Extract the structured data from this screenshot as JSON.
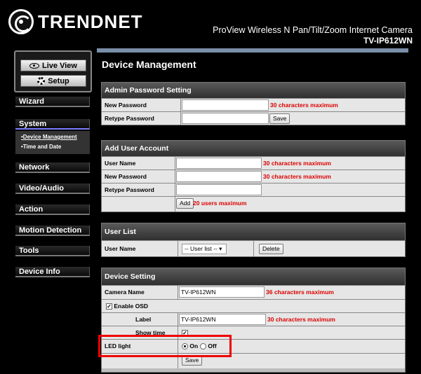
{
  "header": {
    "brand": "TRENDNET",
    "product_title": "ProView Wireless N Pan/Tilt/Zoom Internet Camera",
    "model": "TV-IP612WN"
  },
  "toolbox": {
    "live_view": "Live View",
    "setup": "Setup"
  },
  "sidebar": {
    "items": [
      "Wizard",
      "System",
      "Network",
      "Video/Audio",
      "Action",
      "Motion Detection",
      "Tools",
      "Device Info"
    ],
    "submenu": [
      "•Device Management",
      "•Time and Date"
    ]
  },
  "main": {
    "title": "Device Management",
    "admin": {
      "title": "Admin Password Setting",
      "new_password_label": "New Password",
      "retype_label": "Retype Password",
      "hint": "30 characters maximum",
      "save": "Save"
    },
    "add_user": {
      "title": "Add User Account",
      "user_name_label": "User Name",
      "new_password_label": "New Password",
      "retype_label": "Retype Password",
      "hint": "30 characters maximum",
      "add": "Add",
      "add_hint": "20 users maximum"
    },
    "user_list": {
      "title": "User List",
      "user_name_label": "User Name",
      "select_value": "-- User list --",
      "delete": "Delete"
    },
    "device": {
      "title": "Device Setting",
      "camera_name_label": "Camera Name",
      "camera_name_value": "TV-IP612WN",
      "camera_hint": "36 characters maximum",
      "enable_osd": "Enable OSD",
      "label_label": "Label",
      "label_value": "TV-IP612WN",
      "label_hint": "30 characters maximum",
      "show_time": "Show time",
      "led_label": "LED light",
      "on": "On",
      "off": "Off",
      "save": "Save"
    }
  },
  "colors": {
    "accent_red": "#dd0000",
    "highlight": "#ee0000"
  }
}
